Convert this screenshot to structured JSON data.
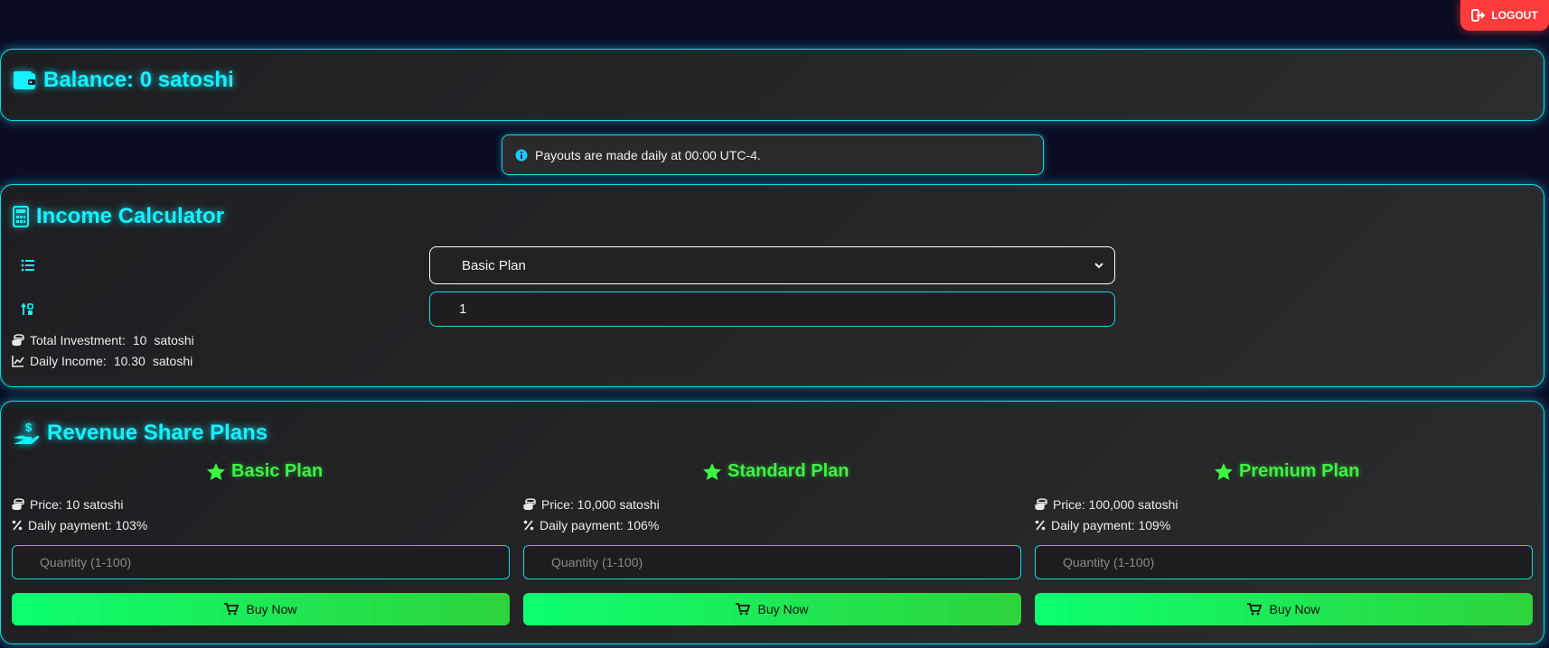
{
  "header": {
    "logout_label": "LOGOUT",
    "logout_icon": "sign-out-icon"
  },
  "balance": {
    "title": "Balance: 0 satoshi",
    "icon": "wallet-icon"
  },
  "notice": {
    "text": "Payouts are made daily at 00:00 UTC-4.",
    "icon": "info-circle-icon"
  },
  "calculator": {
    "title": "Income Calculator",
    "icon": "calculator-icon",
    "plan_select": {
      "value": "Basic Plan",
      "icon": "list-icon"
    },
    "quantity": {
      "value": "1",
      "icon": "sort-numeric-icon"
    },
    "total_investment": {
      "label": "Total Investment:",
      "value": "10",
      "unit": "satoshi"
    },
    "daily_income": {
      "label": "Daily Income:",
      "value": "10.30",
      "unit": "satoshi"
    }
  },
  "plans_section": {
    "title": "Revenue Share Plans",
    "icon": "hand-holding-dollar-icon",
    "plans": [
      {
        "name": "Basic Plan",
        "price": "Price: 10 satoshi",
        "daily": "Daily payment: 103%",
        "placeholder": "Quantity (1-100)",
        "buy_label": "Buy Now"
      },
      {
        "name": "Standard Plan",
        "price": "Price: 10,000 satoshi",
        "daily": "Daily payment: 106%",
        "placeholder": "Quantity (1-100)",
        "buy_label": "Buy Now"
      },
      {
        "name": "Premium Plan",
        "price": "Price: 100,000 satoshi",
        "daily": "Daily payment: 109%",
        "placeholder": "Quantity (1-100)",
        "buy_label": "Buy Now"
      }
    ]
  },
  "colors": {
    "accent": "#18f0ff",
    "plan_title": "#3cf542",
    "logout": "#ff3b3b",
    "background": "#0a0c24"
  }
}
